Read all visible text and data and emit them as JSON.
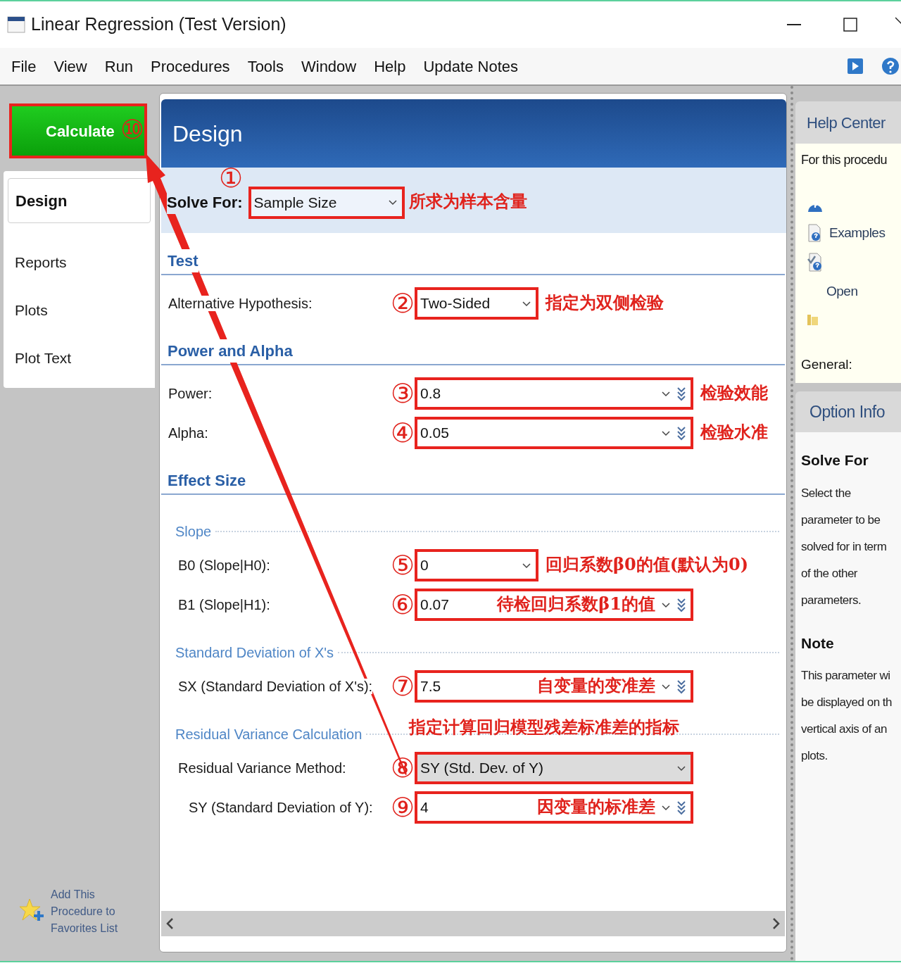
{
  "window": {
    "title": "Linear Regression (Test Version)"
  },
  "menu": [
    "File",
    "View",
    "Run",
    "Procedures",
    "Tools",
    "Window",
    "Help",
    "Update Notes"
  ],
  "calculate": {
    "label": "Calculate",
    "mark": "⑩"
  },
  "sidebar": {
    "tabs": [
      {
        "label": "Design",
        "selected": true
      },
      {
        "label": "Reports",
        "selected": false
      },
      {
        "label": "Plots",
        "selected": false
      },
      {
        "label": "Plot Text",
        "selected": false
      }
    ],
    "favorites": "Add This Procedure to Favorites List"
  },
  "design": {
    "title": "Design",
    "solve_for": {
      "label": "Solve For:",
      "mark": "①",
      "value": "Sample Size",
      "note": "所求为样本含量"
    },
    "sections": [
      {
        "kind": "section",
        "title": "Test",
        "rows": [
          {
            "label": "Alternative Hypothesis:",
            "mark": "②",
            "kind": "dropdown",
            "value": "Two-Sided",
            "note": "指定为双侧检验"
          }
        ]
      },
      {
        "kind": "section",
        "title": "Power and Alpha",
        "rows": [
          {
            "label": "Power:",
            "mark": "③",
            "kind": "spin",
            "value": "0.8",
            "note": "检验效能"
          },
          {
            "label": "Alpha:",
            "mark": "④",
            "kind": "spin",
            "value": "0.05",
            "note": "检验水准"
          }
        ]
      },
      {
        "kind": "section",
        "title": "Effect Size"
      },
      {
        "kind": "subsection",
        "title": "Slope",
        "rows": [
          {
            "label": "B0 (Slope|H0):",
            "mark": "⑤",
            "kind": "dropdown",
            "value": "0",
            "note": "回归系数β0的值(默认为0)"
          },
          {
            "label": "B1 (Slope|H1):",
            "mark": "⑥",
            "kind": "spin",
            "value": "0.07",
            "inside_note": "待检回归系数β1的值"
          }
        ]
      },
      {
        "kind": "subsection",
        "title": "Standard Deviation of X's",
        "rows": [
          {
            "label": "SX (Standard Deviation of X's):",
            "mark": "⑦",
            "kind": "spin",
            "value": "7.5",
            "inside_note": "自变量的变准差"
          }
        ]
      },
      {
        "kind": "subsection",
        "title": "Residual Variance Calculation",
        "rows": [
          {
            "label": "Residual Variance Method:",
            "mark": "⑧",
            "kind": "list",
            "value": "SY (Std. Dev. of Y)",
            "note_above": "指定计算回归模型残差标准差的指标",
            "children": [
              {
                "label": "SY (Standard Deviation of Y):",
                "mark": "⑨",
                "kind": "spin",
                "value": "4",
                "inside_note": "因变量的标准差"
              }
            ]
          }
        ]
      }
    ]
  },
  "help_center": {
    "title": "Help Center",
    "intro": "For this procedu",
    "items": [
      {
        "kind": "help"
      },
      {
        "kind": "examples",
        "label": "Examples"
      },
      {
        "kind": "check"
      },
      {
        "kind": "open",
        "label": "Open"
      },
      {
        "kind": "folder"
      }
    ],
    "general": "General:"
  },
  "option_info": {
    "title": "Option Info",
    "blocks": [
      {
        "heading": "Solve For",
        "lines": [
          "Select the",
          "parameter to be",
          "solved for in term",
          "of the other",
          "parameters."
        ]
      },
      {
        "heading": "Note",
        "lines": [
          "This parameter wi",
          "be displayed on th",
          "vertical axis of an",
          "plots."
        ]
      }
    ]
  }
}
